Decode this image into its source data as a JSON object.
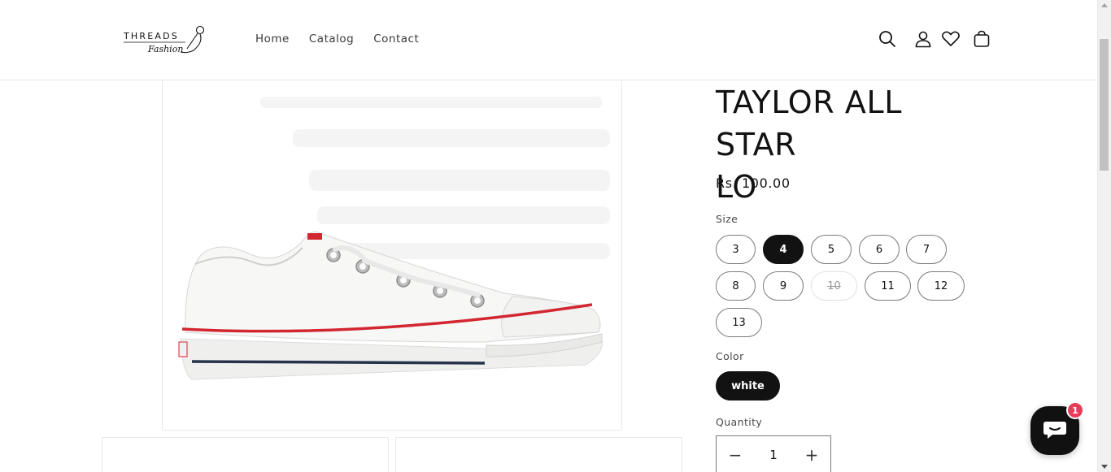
{
  "header": {
    "logo": {
      "text_top": "THREADS",
      "text_bottom": "Fashion"
    },
    "nav": [
      {
        "label": "Home"
      },
      {
        "label": "Catalog"
      },
      {
        "label": "Contact"
      }
    ],
    "icons": [
      "search-icon",
      "account-icon",
      "wishlist-heart-icon",
      "cart-icon"
    ]
  },
  "product": {
    "title_line1": "TAYLOR ALL STAR",
    "title_line2": "LO",
    "price": "Rs. 100.00",
    "size_label": "Size",
    "sizes": [
      {
        "label": "3",
        "selected": false,
        "available": true
      },
      {
        "label": "4",
        "selected": true,
        "available": true
      },
      {
        "label": "5",
        "selected": false,
        "available": true
      },
      {
        "label": "6",
        "selected": false,
        "available": true
      },
      {
        "label": "7",
        "selected": false,
        "available": true
      },
      {
        "label": "8",
        "selected": false,
        "available": true
      },
      {
        "label": "9",
        "selected": false,
        "available": true
      },
      {
        "label": "10",
        "selected": false,
        "available": false
      },
      {
        "label": "11",
        "selected": false,
        "available": true
      },
      {
        "label": "12",
        "selected": false,
        "available": true
      },
      {
        "label": "13",
        "selected": false,
        "available": true
      }
    ],
    "color_label": "Color",
    "colors": [
      {
        "label": "white",
        "selected": true
      }
    ],
    "quantity_label": "Quantity",
    "quantity": "1",
    "quantity_minus": "−",
    "quantity_plus": "+"
  },
  "chat": {
    "badge_count": "1"
  },
  "colors": {
    "accent": "#121212",
    "badge": "#e53e5b",
    "shoe_red_stripe": "#d22630",
    "shoe_navy_stripe": "#27324d"
  }
}
